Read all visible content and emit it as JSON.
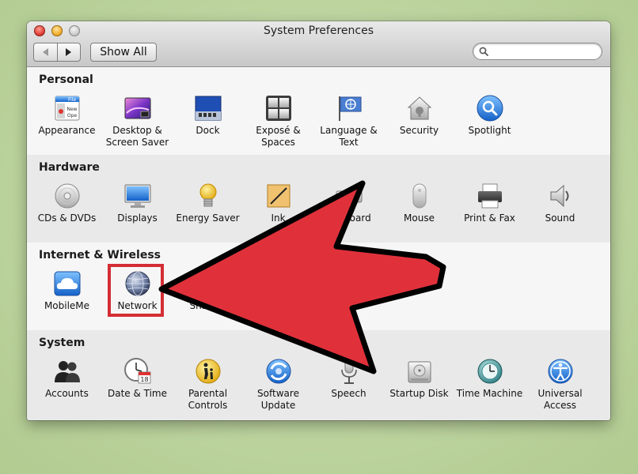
{
  "window": {
    "title": "System Preferences",
    "show_all_label": "Show All",
    "search_placeholder": ""
  },
  "sections": [
    {
      "title": "Personal",
      "items": [
        {
          "label": "Appearance",
          "icon": "appearance-icon"
        },
        {
          "label": "Desktop & Screen Saver",
          "icon": "desktop-screen-saver-icon"
        },
        {
          "label": "Dock",
          "icon": "dock-icon"
        },
        {
          "label": "Exposé & Spaces",
          "icon": "expose-spaces-icon"
        },
        {
          "label": "Language & Text",
          "icon": "language-text-icon"
        },
        {
          "label": "Security",
          "icon": "security-icon"
        },
        {
          "label": "Spotlight",
          "icon": "spotlight-icon"
        }
      ]
    },
    {
      "title": "Hardware",
      "items": [
        {
          "label": "CDs & DVDs",
          "icon": "cd-dvd-icon"
        },
        {
          "label": "Displays",
          "icon": "displays-icon"
        },
        {
          "label": "Energy Saver",
          "icon": "energy-saver-icon"
        },
        {
          "label": "Ink",
          "icon": "ink-icon"
        },
        {
          "label": "Keyboard",
          "icon": "keyboard-icon"
        },
        {
          "label": "Mouse",
          "icon": "mouse-icon"
        },
        {
          "label": "Print & Fax",
          "icon": "printer-icon"
        },
        {
          "label": "Sound",
          "icon": "speaker-icon"
        }
      ]
    },
    {
      "title": "Internet & Wireless",
      "items": [
        {
          "label": "MobileMe",
          "icon": "mobileme-cloud-icon"
        },
        {
          "label": "Network",
          "icon": "network-globe-icon"
        },
        {
          "label": "Sharing",
          "icon": "sharing-icon"
        }
      ]
    },
    {
      "title": "System",
      "items": [
        {
          "label": "Accounts",
          "icon": "accounts-icon"
        },
        {
          "label": "Date & Time",
          "icon": "clock-calendar-icon",
          "badge": "18"
        },
        {
          "label": "Parental Controls",
          "icon": "parental-controls-icon"
        },
        {
          "label": "Software Update",
          "icon": "software-update-icon"
        },
        {
          "label": "Speech",
          "icon": "microphone-icon"
        },
        {
          "label": "Startup Disk",
          "icon": "hard-disk-icon"
        },
        {
          "label": "Time Machine",
          "icon": "time-machine-icon"
        },
        {
          "label": "Universal Access",
          "icon": "universal-access-icon"
        }
      ]
    }
  ],
  "annotation": {
    "highlight_color": "#d42d35",
    "arrow_color": "#e0313b",
    "highlighted_item": "Network"
  }
}
